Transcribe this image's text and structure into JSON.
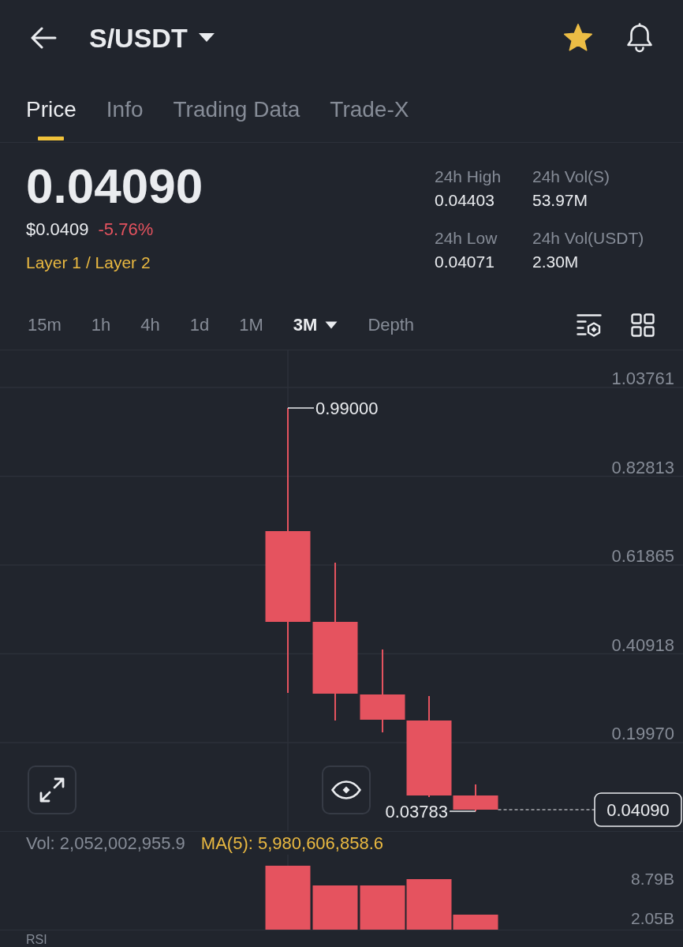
{
  "header": {
    "title": "S/USDT",
    "favorite": true
  },
  "tabs": [
    {
      "label": "Price",
      "selected": true
    },
    {
      "label": "Info",
      "selected": false
    },
    {
      "label": "Trading Data",
      "selected": false
    },
    {
      "label": "Trade-X",
      "selected": false
    }
  ],
  "ticker": {
    "last_price": "0.04090",
    "fiat_price": "$0.0409",
    "change": "-5.76%",
    "change_negative": true,
    "category": "Layer 1 / Layer 2",
    "stats": [
      {
        "label": "24h High",
        "value": "0.04403"
      },
      {
        "label": "24h Vol(S)",
        "value": "53.97M"
      },
      {
        "label": "24h Low",
        "value": "0.04071"
      },
      {
        "label": "24h Vol(USDT)",
        "value": "2.30M"
      }
    ]
  },
  "intervals": [
    {
      "label": "15m",
      "kind": "interval",
      "selected": false
    },
    {
      "label": "1h",
      "kind": "interval",
      "selected": false
    },
    {
      "label": "4h",
      "kind": "interval",
      "selected": false
    },
    {
      "label": "1d",
      "kind": "interval",
      "selected": false
    },
    {
      "label": "1M",
      "kind": "interval",
      "selected": false
    },
    {
      "label": "3M",
      "kind": "menu",
      "selected": true
    },
    {
      "label": "Depth",
      "kind": "interval",
      "selected": false
    }
  ],
  "price_chart": {
    "axis_labels": [
      "1.03761",
      "0.82813",
      "0.61865",
      "0.40918",
      "0.19970"
    ],
    "candles": [
      {
        "falling": true
      },
      {
        "falling": true
      },
      {
        "falling": true
      },
      {
        "falling": true
      },
      {
        "falling": true
      }
    ],
    "high_label": "0.99000",
    "low_label": "0.03783",
    "last_price": "0.04090"
  },
  "volume": {
    "legend": [
      {
        "kind": "vol",
        "text": "Vol: 2,052,002,955.9"
      },
      {
        "kind": "ma",
        "text": "MA(5): 5,980,606,858.6"
      }
    ],
    "axis_labels": [
      "8.79B",
      "2.05B"
    ],
    "bars": [
      {
        "falling": true
      },
      {
        "falling": true
      },
      {
        "falling": true
      },
      {
        "falling": true
      },
      {
        "falling": true
      }
    ]
  },
  "rsi": {
    "label": "RSI"
  }
}
